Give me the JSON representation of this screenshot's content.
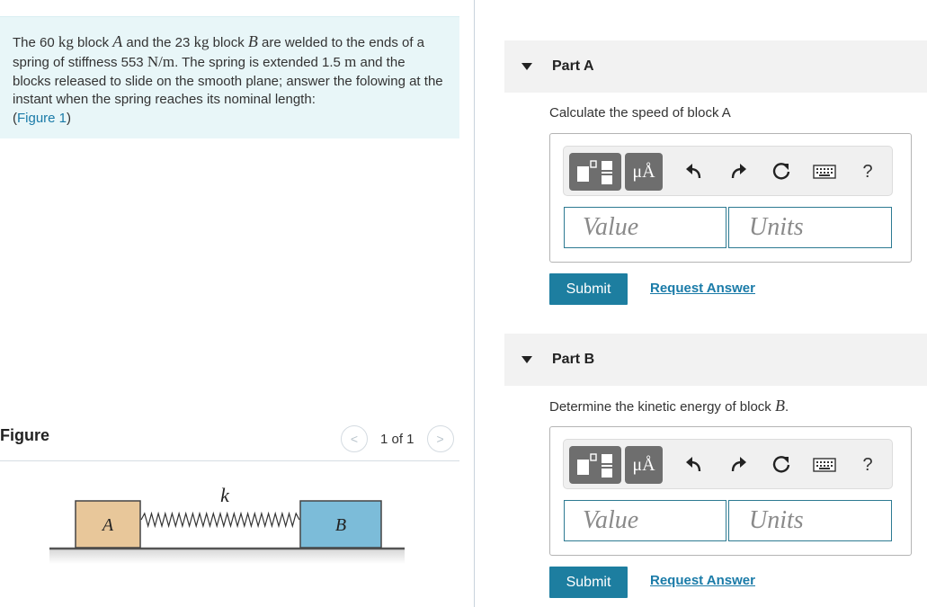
{
  "problem": {
    "text_1": "The 60",
    "unit_kg_a": "kg",
    "text_2": "block",
    "block_a": "A",
    "text_3": "and the 23",
    "unit_kg_b": "kg",
    "text_4": "block",
    "block_b": "B",
    "text_5": "are welded to the ends of a spring of stiffness 553",
    "unit_stiffness": "N/m",
    "text_6": ". The spring is extended 1.5",
    "unit_m": "m",
    "text_7": "and the blocks released to slide on the smooth plane; answer the folowing at the instant when the spring reaches its nominal length:",
    "figure_link_prefix": "(",
    "figure_link": "Figure 1",
    "figure_link_suffix": ")"
  },
  "figure": {
    "title": "Figure",
    "counter": "1 of 1",
    "prev": "<",
    "next": ">",
    "block_a_label": "A",
    "block_b_label": "B",
    "spring_label": "k",
    "colors": {
      "block_a": "#e8c79a",
      "block_b": "#7cbcd9",
      "ground": "#555555"
    }
  },
  "parts": [
    {
      "label": "Part A",
      "question_text": "Calculate the speed of block A",
      "question_var": "",
      "question_suffix": "",
      "units_symbol": "μÅ",
      "help": "?",
      "value_placeholder": "Value",
      "units_placeholder": "Units",
      "submit": "Submit",
      "request": "Request Answer"
    },
    {
      "label": "Part B",
      "question_text": "Determine the kinetic energy of block",
      "question_var": "B",
      "question_suffix": ".",
      "units_symbol": "μÅ",
      "help": "?",
      "value_placeholder": "Value",
      "units_placeholder": "Units",
      "submit": "Submit",
      "request": "Request Answer"
    }
  ],
  "colors": {
    "accent": "#1d7ea0",
    "link": "#1a7ba8",
    "problem_bg": "#e8f6f8"
  },
  "icons": [
    "templates-icon",
    "undo-icon",
    "redo-icon",
    "reset-icon",
    "keyboard-icon"
  ]
}
